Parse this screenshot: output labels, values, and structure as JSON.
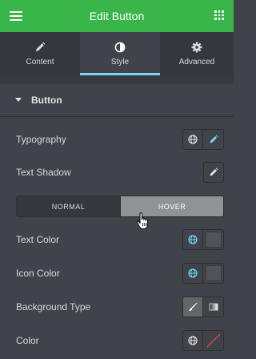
{
  "header": {
    "title": "Edit Button",
    "menu_icon": "hamburger-menu-icon",
    "grid_icon": "widgets-grid-icon",
    "color": "#39b54a"
  },
  "tabs": [
    {
      "label": "Content",
      "icon": "pencil-icon",
      "active": false
    },
    {
      "label": "Style",
      "icon": "half-circle-contrast-icon",
      "active": true
    },
    {
      "label": "Advanced",
      "icon": "gear-icon",
      "active": false
    }
  ],
  "section": {
    "title": "Button",
    "expanded": true
  },
  "controls": {
    "typography": {
      "label": "Typography"
    },
    "text_shadow": {
      "label": "Text Shadow"
    },
    "state_toggle": {
      "normal": "NORMAL",
      "hover": "HOVER",
      "selected": "HOVER"
    },
    "text_color": {
      "label": "Text Color"
    },
    "icon_color": {
      "label": "Icon Color"
    },
    "background_type": {
      "label": "Background Type",
      "selected": "classic"
    },
    "color": {
      "label": "Color"
    }
  },
  "accent": "#71d7f7",
  "globe_active_color": "#71d7f7"
}
